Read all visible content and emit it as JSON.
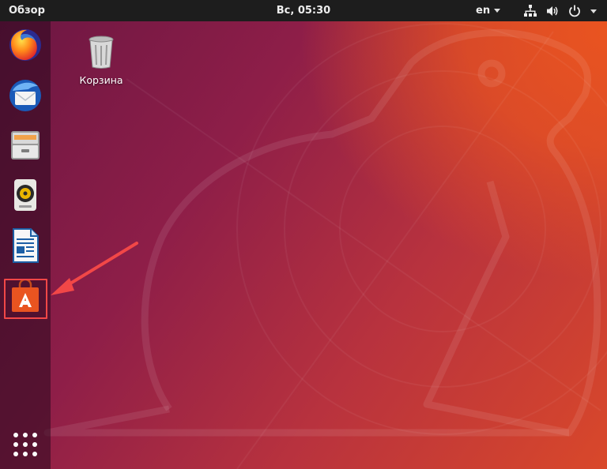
{
  "top_panel": {
    "activities_label": "Обзор",
    "clock": "Вс, 05:30",
    "language": "en",
    "tray_icons": [
      "network-icon",
      "volume-icon",
      "power-icon"
    ]
  },
  "dock": {
    "items": [
      {
        "name": "firefox",
        "icon": "firefox-icon"
      },
      {
        "name": "thunderbird",
        "icon": "thunderbird-icon"
      },
      {
        "name": "files",
        "icon": "files-icon"
      },
      {
        "name": "rhythmbox",
        "icon": "rhythmbox-icon"
      },
      {
        "name": "libreoffice-writer",
        "icon": "libreoffice-writer-icon"
      },
      {
        "name": "ubuntu-software",
        "icon": "ubuntu-software-icon",
        "highlighted": true
      }
    ],
    "show_apps_icon": "apps-grid-icon"
  },
  "desktop": {
    "icons": [
      {
        "label": "Корзина",
        "icon": "trash-icon"
      }
    ]
  },
  "annotation": {
    "type": "arrow",
    "color": "#f24747",
    "target": "ubuntu-software"
  },
  "colors": {
    "panel": "#1d1d1d",
    "accent": "#e95420",
    "highlight": "#f24747"
  }
}
